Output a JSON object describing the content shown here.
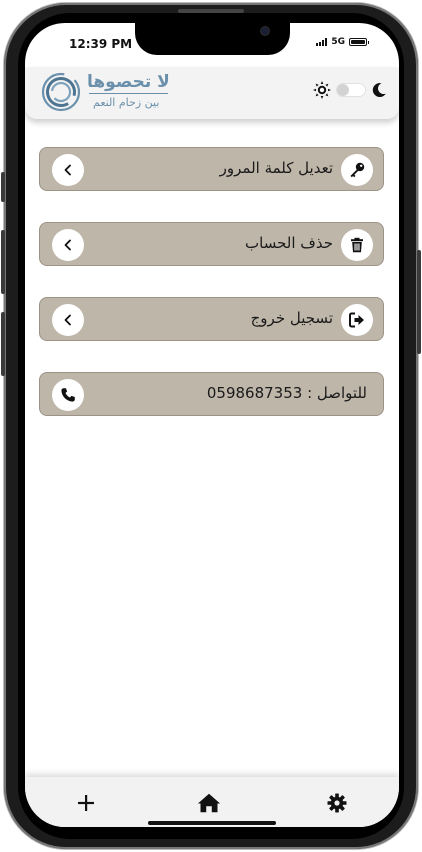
{
  "status_bar": {
    "time": "12:39 PM",
    "network": "5G"
  },
  "header": {
    "logo_title": "لا تحصوها",
    "logo_subtitle": "بين زحام النعم",
    "theme": {
      "mode": "light",
      "sun_icon": "sun-icon",
      "moon_icon": "moon-icon"
    },
    "brand_color": "#6b90ab"
  },
  "menu": {
    "items": [
      {
        "label": "تعديل كلمة المرور",
        "icon": "key-icon"
      },
      {
        "label": "حذف الحساب",
        "icon": "trash-icon"
      },
      {
        "label": "تسجيل خروج",
        "icon": "logout-icon"
      }
    ],
    "row_color": "#bfb6aa"
  },
  "contact": {
    "prefix": "للتواصل :",
    "phone": "0598687353",
    "icon": "phone-icon"
  },
  "bottom_nav": {
    "items": [
      {
        "name": "add",
        "icon": "plus-icon"
      },
      {
        "name": "home",
        "icon": "home-icon"
      },
      {
        "name": "settings",
        "icon": "gear-icon"
      }
    ]
  }
}
